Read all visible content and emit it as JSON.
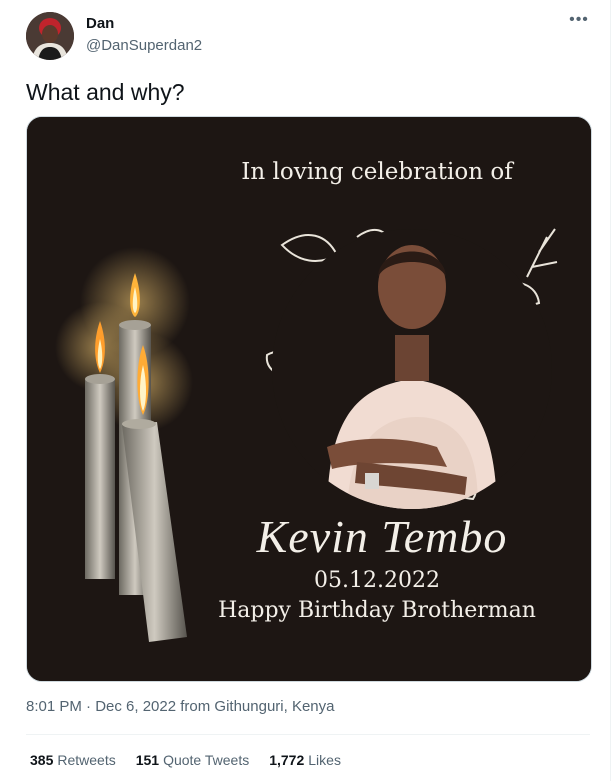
{
  "author": {
    "name": "Dan",
    "handle": "@DanSuperdan2"
  },
  "tweet": {
    "text": "What and why?",
    "meta": "8:01 PM · Dec 6, 2022 from Githunguri, Kenya"
  },
  "media": {
    "headline": "In loving celebration of",
    "person_name": "Kevin Tembo",
    "date": "05.12.2022",
    "message": "Happy Birthday Brotherman"
  },
  "stats": {
    "retweets_count": "385",
    "retweets_label": "Retweets",
    "quotes_count": "151",
    "quotes_label": "Quote Tweets",
    "likes_count": "1,772",
    "likes_label": "Likes"
  },
  "more_icon": "more-horizontal-icon"
}
